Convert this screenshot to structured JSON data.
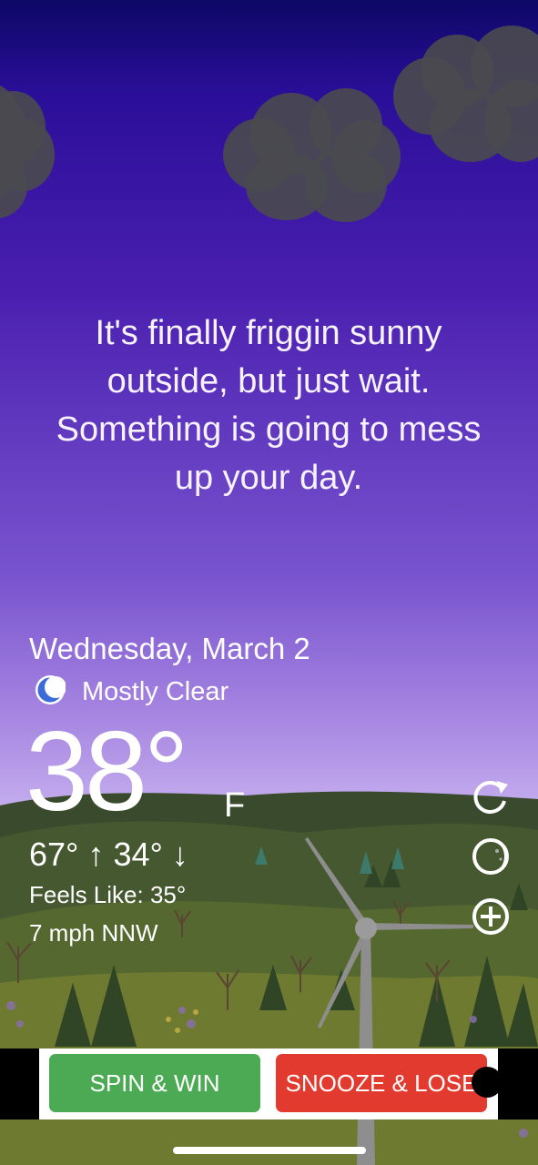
{
  "message": "It's finally friggin sunny outside, but just wait. Something is going to mess up your day.",
  "weather": {
    "date": "Wednesday, March 2",
    "condition": "Mostly Clear",
    "condition_icon": "crescent-moon-icon",
    "temperature": "38°",
    "unit": "F",
    "hi_lo": "67° ↑  34° ↓",
    "feels_like": "Feels Like: 35°",
    "wind": "7 mph NNW"
  },
  "side_actions": [
    {
      "icon": "refresh-icon"
    },
    {
      "icon": "moon-phase-icon"
    },
    {
      "icon": "add-icon"
    }
  ],
  "ad": {
    "spin_label": "SPIN & WIN",
    "snooze_label": "SNOOZE & LOSE"
  },
  "colors": {
    "spin": "#4caa54",
    "snooze": "#e33a30",
    "sky_top": "#0d0866",
    "sky_bottom": "#d5c3f4"
  }
}
